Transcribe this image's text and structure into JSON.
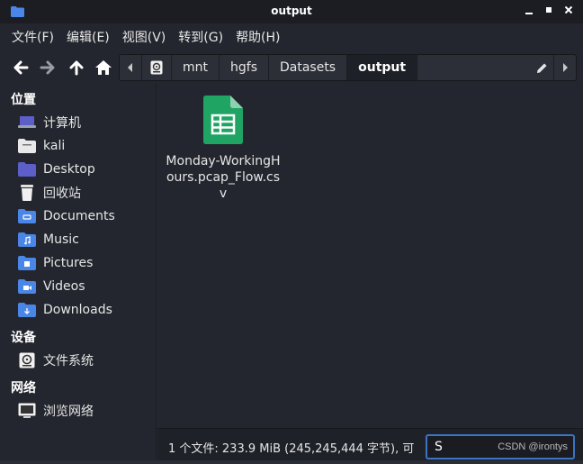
{
  "window": {
    "title": "output"
  },
  "menu": [
    {
      "label": "文件(F)"
    },
    {
      "label": "编辑(E)"
    },
    {
      "label": "视图(V)"
    },
    {
      "label": "转到(G)"
    },
    {
      "label": "帮助(H)"
    }
  ],
  "pathbar": {
    "crumbs": [
      {
        "label": "mnt"
      },
      {
        "label": "hgfs"
      },
      {
        "label": "Datasets"
      },
      {
        "label": "output"
      }
    ]
  },
  "sidebar": {
    "sections": {
      "places": "位置",
      "devices": "设备",
      "network": "网络"
    },
    "places": [
      {
        "label": "计算机",
        "icon": "computer-icon"
      },
      {
        "label": "kali",
        "icon": "home-folder-icon"
      },
      {
        "label": "Desktop",
        "icon": "desktop-folder-icon"
      },
      {
        "label": "回收站",
        "icon": "trash-icon"
      },
      {
        "label": "Documents",
        "icon": "documents-folder-icon"
      },
      {
        "label": "Music",
        "icon": "music-folder-icon"
      },
      {
        "label": "Pictures",
        "icon": "pictures-folder-icon"
      },
      {
        "label": "Videos",
        "icon": "videos-folder-icon"
      },
      {
        "label": "Downloads",
        "icon": "downloads-folder-icon"
      }
    ],
    "devices": [
      {
        "label": "文件系统",
        "icon": "drive-icon"
      }
    ],
    "network": [
      {
        "label": "浏览网络",
        "icon": "network-icon"
      }
    ]
  },
  "files": [
    {
      "name": "Monday-WorkingHours.pcap_Flow.csv",
      "icon": "spreadsheet-icon"
    }
  ],
  "status": {
    "text": "1 个文件: 233.9 MiB (245,245,444 字节), 可",
    "search_value": "S",
    "watermark": "CSDN @irontys"
  },
  "colors": {
    "accent": "#3b74c4",
    "folder": "#4a86e8",
    "spreadsheet": "#1fa463"
  }
}
